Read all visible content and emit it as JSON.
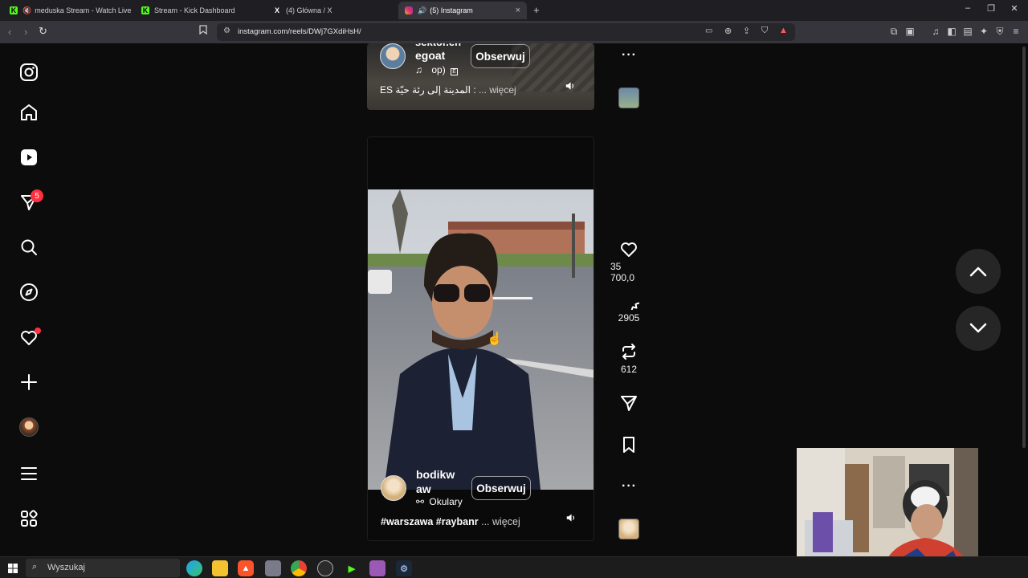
{
  "browser": {
    "tabs": [
      {
        "label": "meduska Stream - Watch Live on",
        "favicon": "kick-icon",
        "color": "#53fc18"
      },
      {
        "label": "Stream - Kick Dashboard",
        "favicon": "kick-icon",
        "color": "#53fc18"
      },
      {
        "label": "(4) Główna / X",
        "favicon": "x-icon",
        "color": "#ffffff"
      },
      {
        "label": "(5) Instagram",
        "favicon": "instagram-icon",
        "color": "#e1306c"
      }
    ],
    "new_tab": "+",
    "url": "instagram.com/reels/DWj7GXdiHsH/"
  },
  "sidebar": {
    "items": [
      {
        "name": "instagram-logo-icon"
      },
      {
        "name": "home-icon"
      },
      {
        "name": "reels-icon"
      },
      {
        "name": "messages-icon",
        "badge": "5"
      },
      {
        "name": "search-icon"
      },
      {
        "name": "explore-icon"
      },
      {
        "name": "notifications-icon"
      },
      {
        "name": "create-icon"
      },
      {
        "name": "profile-avatar"
      },
      {
        "name": "menu-icon"
      },
      {
        "name": "also-from-meta-icon"
      }
    ]
  },
  "reel_top": {
    "username_line1": "sektor.eh",
    "username_line2": "egoat",
    "follow_label": "Obserwuj",
    "audio_text": "op)",
    "caption": "ES المدينة إلى رئة حيّة :",
    "more_label": "... więcej"
  },
  "reel_main": {
    "username_line1": "bodikw",
    "username_line2": "aw",
    "follow_label": "Obserwuj",
    "tag_text": "Okulary",
    "caption": "#warszawa #raybanr",
    "more_label": "... więcej"
  },
  "actions": {
    "likes": "35 700,0",
    "comments": "2905",
    "reposts": "612"
  },
  "taskbar": {
    "search_placeholder": "Wyszukaj"
  },
  "colors": {
    "background": "#0c0c0c",
    "notification_red": "#ff3040",
    "kick_green": "#53fc18"
  }
}
